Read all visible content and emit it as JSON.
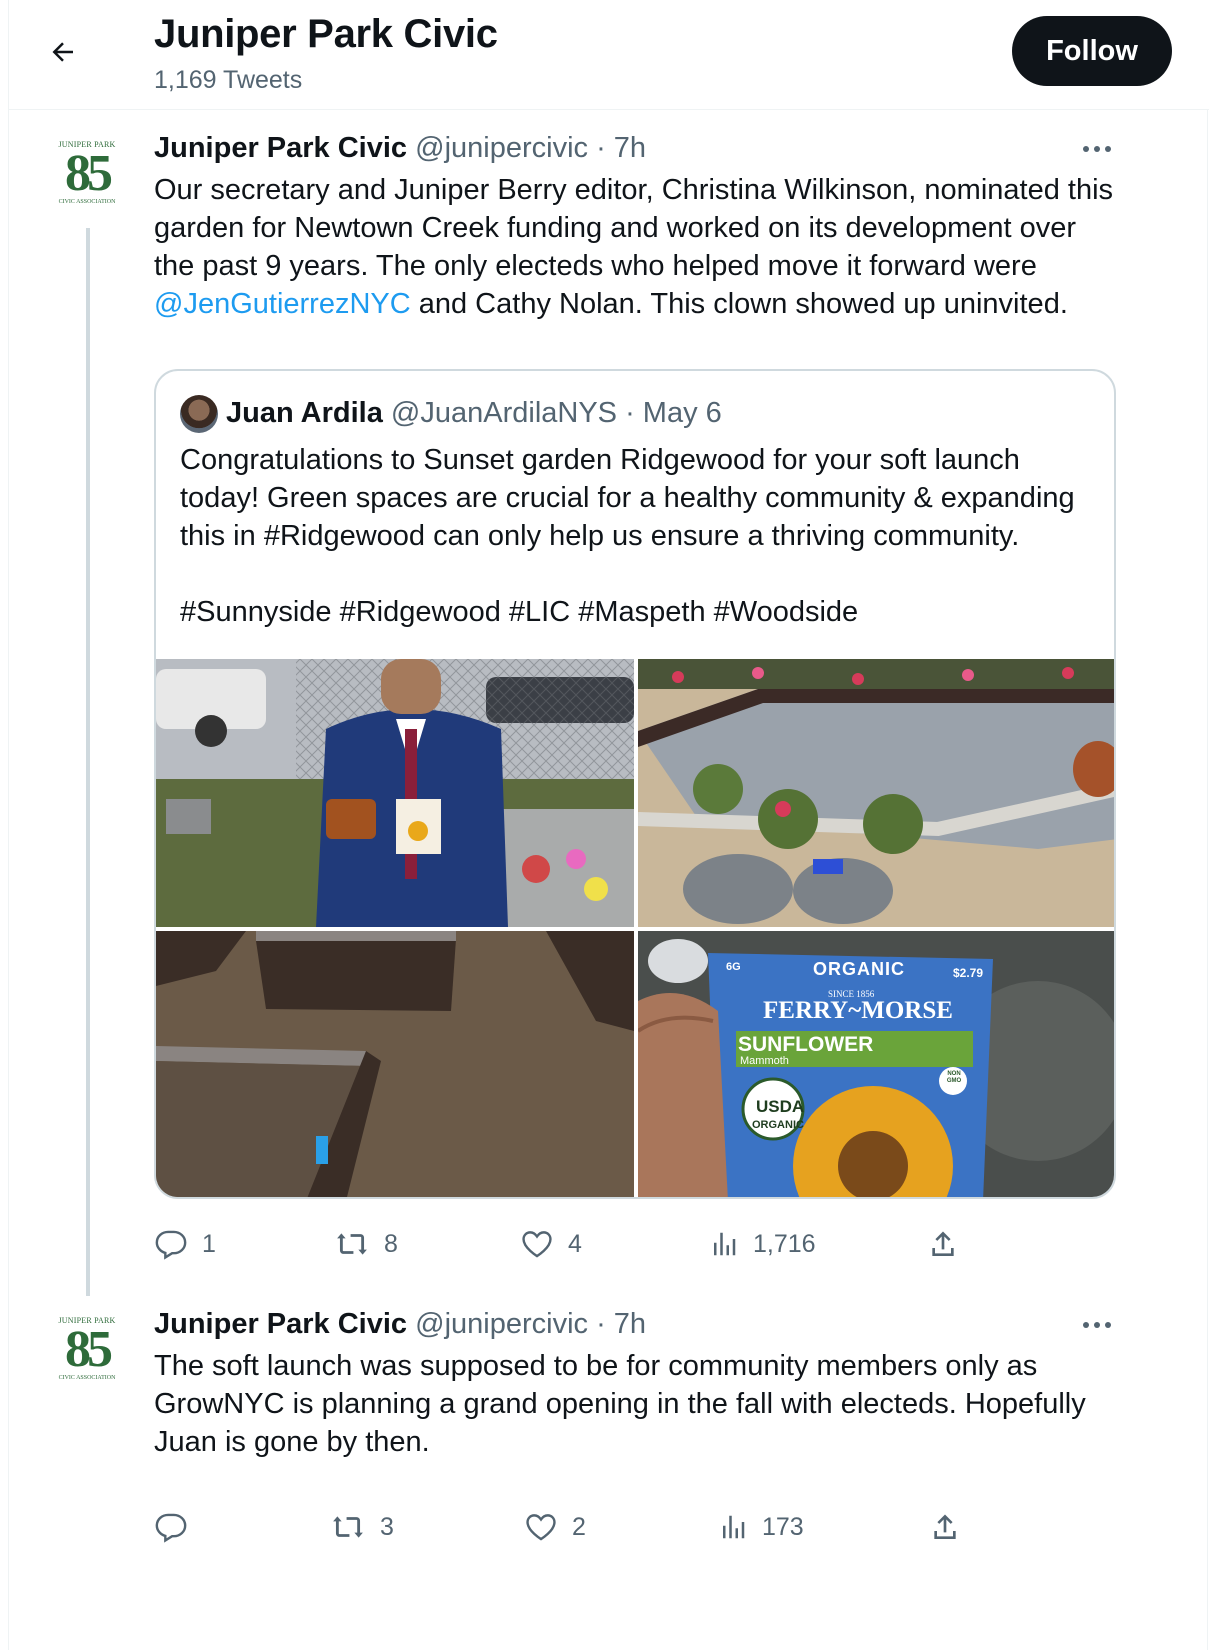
{
  "header": {
    "title": "Juniper Park Civic",
    "tweet_count": "1,169 Tweets",
    "follow_label": "Follow"
  },
  "avatar_logo": {
    "top_text": "JUNIPER PARK",
    "number": "85",
    "bottom_text": "CIVIC ASSOCIATION"
  },
  "tweet1": {
    "name": "Juniper Park Civic",
    "handle": "@junipercivic",
    "time": "· 7h",
    "text_part1": "Our secretary and Juniper Berry editor, Christina Wilkinson, nominated this garden for Newtown Creek funding and worked on its development over the past 9 years. The only electeds who helped move it forward were",
    "mention": "@JenGutierrezNYC",
    "text_part2": " and Cathy Nolan. This clown showed up uninvited.",
    "quote": {
      "name": "Juan Ardila",
      "handle": "@JuanArdilaNYS",
      "time": "· May 6",
      "text": "Congratulations to Sunset garden Ridgewood for your soft launch today! Green spaces are crucial for a healthy community & expanding this in #Ridgewood can only help us ensure a thriving community.",
      "hashtags": "#Sunnyside #Ridgewood #LIC #Maspeth #Woodside"
    },
    "seed_packet": {
      "weight": "6G",
      "organic": "ORGANIC",
      "price": "$2.79",
      "since": "SINCE 1856",
      "brand": "FERRY~MORSE",
      "variety": "SUNFLOWER",
      "sub": "Mammoth",
      "usda": "USDA",
      "usda_sub": "ORGANIC",
      "non_gmo": "NON GMO"
    },
    "stats": {
      "replies": "1",
      "retweets": "8",
      "likes": "4",
      "views": "1,716"
    }
  },
  "tweet2": {
    "name": "Juniper Park Civic",
    "handle": "@junipercivic",
    "time": "· 7h",
    "text": "The soft launch was supposed to be for community members only as GrowNYC is planning a grand opening in the fall with electeds. Hopefully Juan is gone by then.",
    "stats": {
      "replies": "",
      "retweets": "3",
      "likes": "2",
      "views": "173"
    }
  }
}
